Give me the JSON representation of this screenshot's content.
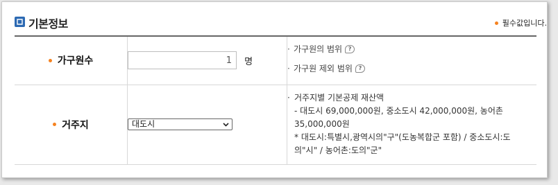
{
  "section": {
    "title": "기본정보",
    "required_note": "필수값입니다."
  },
  "household": {
    "label": "가구원수",
    "value": "1",
    "unit": "명",
    "links": [
      "가구원의 범위",
      "가구원 제외 범위"
    ]
  },
  "residence": {
    "label": "거주지",
    "selected": "대도시",
    "info_lines": [
      "거주지별 기본공제 재산액",
      "- 대도시 69,000,000원, 중소도시 42,000,000원, 농어촌",
      "35,000,000원",
      "* 대도시:특별시,광역시의\"구\"(도농복합군 포함) / 중소도시:도",
      "의\"시\" / 농어촌:도의\"군\""
    ]
  },
  "colors": {
    "accent_dot": "#f58220",
    "title_icon": "#2d6ab3"
  }
}
